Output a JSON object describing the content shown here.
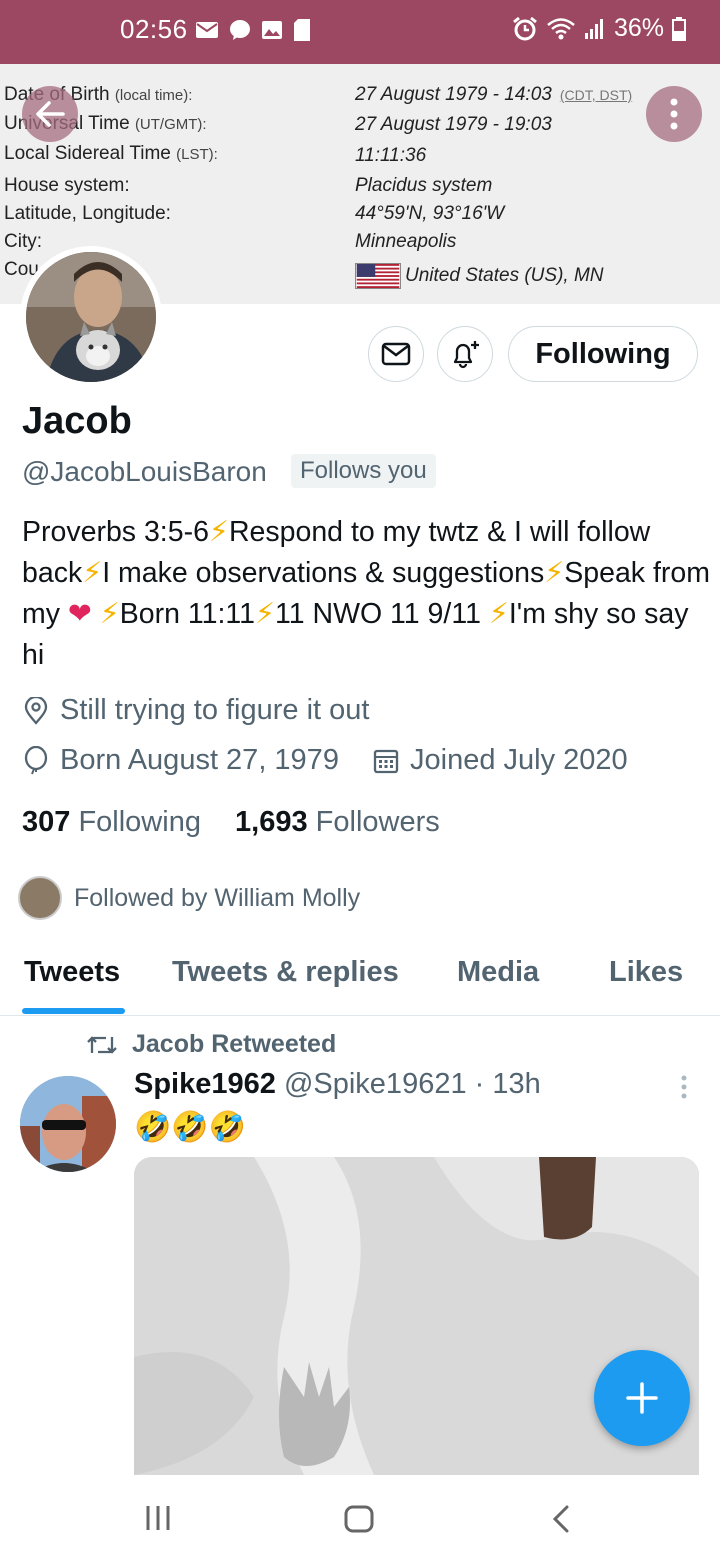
{
  "status_bar": {
    "time": "02:56",
    "battery": "36%",
    "notification_icons": [
      "mail-icon",
      "chat-icon",
      "gallery-icon",
      "sd-card-icon"
    ],
    "system_icons": [
      "alarm-icon",
      "wifi-icon",
      "signal-icon",
      "battery-icon"
    ]
  },
  "banner": {
    "rows": [
      {
        "label": "Date of Birth",
        "sub": "(local time):",
        "value": "27 August 1979 - 14:03",
        "link": "(CDT, DST)"
      },
      {
        "label": "Universal Time",
        "sub": "(UT/GMT):",
        "value": "27 August 1979 - 19:03"
      },
      {
        "label": "Local Sidereal Time",
        "sub": "(LST):",
        "value": "11:11:36"
      },
      {
        "label": "House system:",
        "value": "Placidus system"
      },
      {
        "label": "Latitude, Longitude:",
        "value": "44°59'N, 93°16'W"
      },
      {
        "label": "City:",
        "value": "Minneapolis"
      },
      {
        "label": "Cou",
        "value": "United States (US), MN"
      }
    ]
  },
  "profile": {
    "name": "Jacob",
    "handle": "@JacobLouisBaron",
    "follows_you": "Follows you",
    "follow_button": "Following",
    "bio": {
      "p1": "Proverbs 3:5-6",
      "p2": "Respond to my twtz & I will follow back",
      "p3": "I make observations & suggestions",
      "p4": "Speak from my",
      "p5": "Born 11:11",
      "p6": "11 NWO 11 9/11",
      "p7": "I'm shy so say hi"
    },
    "location": "Still trying to figure it out",
    "birthday": "Born August 27, 1979",
    "joined": "Joined July 2020",
    "following_count": "307",
    "following_label": "Following",
    "followers_count": "1,693",
    "followers_label": "Followers",
    "followed_by": "Followed by William Molly"
  },
  "tabs": [
    {
      "label": "Tweets",
      "active": true
    },
    {
      "label": "Tweets & replies"
    },
    {
      "label": "Media"
    },
    {
      "label": "Likes"
    }
  ],
  "tweet": {
    "retweeted_by": "Jacob Retweeted",
    "display_name": "Spike1962",
    "handle": "@Spike19621",
    "time": "· 13h",
    "text": "🤣🤣🤣"
  },
  "colors": {
    "accent": "#1d9bf0",
    "status_bar": "#9c4862",
    "muted_text": "#536471",
    "lightning": "#f4b400",
    "heart": "#e0245e"
  }
}
